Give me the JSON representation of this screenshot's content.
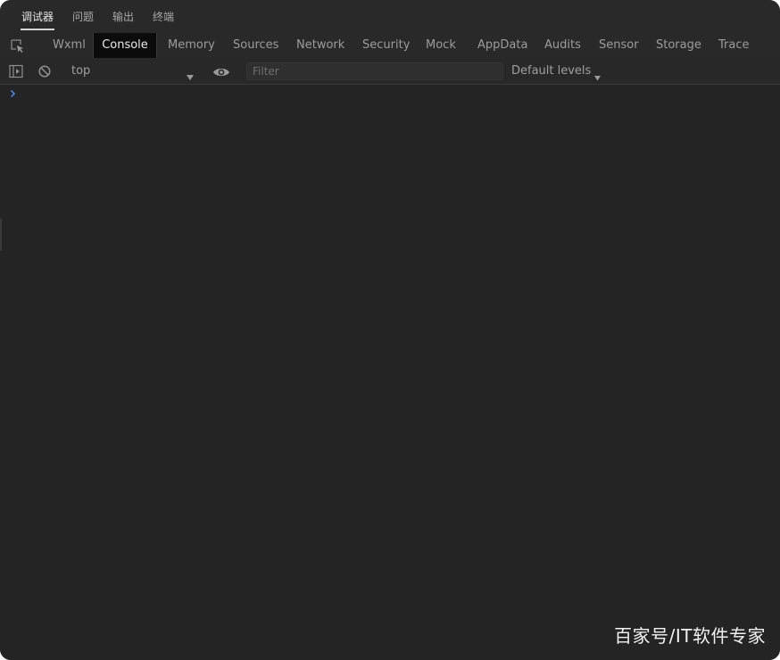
{
  "panel_tabs": [
    {
      "label": "调试器",
      "active": true
    },
    {
      "label": "问题",
      "active": false
    },
    {
      "label": "输出",
      "active": false
    },
    {
      "label": "终端",
      "active": false
    }
  ],
  "tool_tabs": [
    {
      "label": "Wxml",
      "active": false
    },
    {
      "label": "Console",
      "active": true
    },
    {
      "label": "Memory",
      "active": false
    },
    {
      "label": "Sources",
      "active": false
    },
    {
      "label": "Network",
      "active": false
    },
    {
      "label": "Security",
      "active": false
    },
    {
      "label": "Mock",
      "active": false
    },
    {
      "label": "AppData",
      "active": false
    },
    {
      "label": "Audits",
      "active": false
    },
    {
      "label": "Sensor",
      "active": false
    },
    {
      "label": "Storage",
      "active": false
    },
    {
      "label": "Trace",
      "active": false
    }
  ],
  "toolbar": {
    "context_value": "top",
    "filter_placeholder": "Filter",
    "filter_value": "",
    "levels_label": "Default levels"
  },
  "icons": {
    "inspect": "inspect-element-icon",
    "sidebar": "show-sidebar-icon",
    "clear": "clear-console-icon",
    "eye": "live-expression-icon",
    "prompt": "console-prompt-icon"
  },
  "colors": {
    "background": "#242424",
    "active_tab_bg": "#0b0b0b",
    "prompt_accent": "#4d8bf5"
  },
  "watermark": "百家号/IT软件专家"
}
